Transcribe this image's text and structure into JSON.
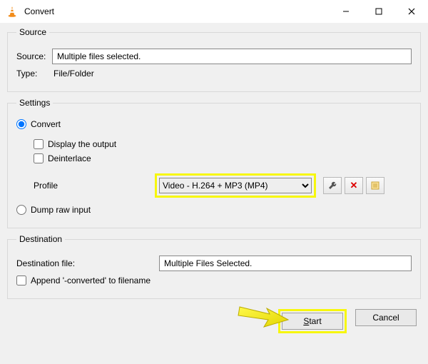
{
  "window": {
    "title": "Convert"
  },
  "source_group": {
    "legend": "Source",
    "source_label": "Source:",
    "source_value": "Multiple files selected.",
    "type_label": "Type:",
    "type_value": "File/Folder"
  },
  "settings_group": {
    "legend": "Settings",
    "convert_radio": "Convert",
    "display_output": "Display the output",
    "deinterlace": "Deinterlace",
    "profile_label": "Profile",
    "profile_selected": "Video - H.264 + MP3 (MP4)",
    "dump_raw": "Dump raw input"
  },
  "destination_group": {
    "legend": "Destination",
    "dest_file_label": "Destination file:",
    "dest_file_value": "Multiple Files Selected.",
    "append_converted": "Append '-converted' to filename"
  },
  "buttons": {
    "start_prefix": "S",
    "start_rest": "tart",
    "cancel": "Cancel"
  }
}
